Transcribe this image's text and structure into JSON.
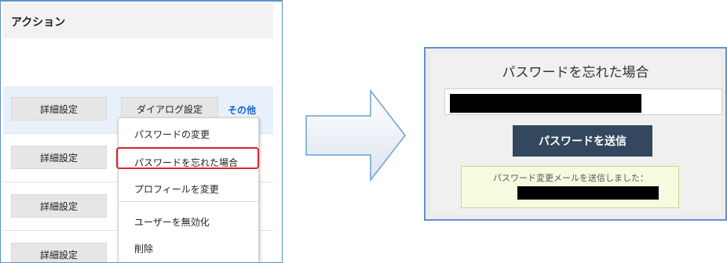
{
  "left": {
    "header": "アクション",
    "rows": [
      {
        "detail": "詳細設定",
        "dialog": "ダイアログ設定",
        "other": "その他"
      },
      {
        "detail": "詳細設定"
      },
      {
        "detail": "詳細設定"
      },
      {
        "detail": "詳細設定"
      }
    ],
    "menu": [
      "パスワードの変更",
      "パスワードを忘れた場合",
      "プロフィールを変更",
      "ユーザーを無効化",
      "削除"
    ]
  },
  "right": {
    "title": "パスワードを忘れた場合",
    "send_label": "パスワードを送信",
    "success_message": "パスワード変更メールを送信しました："
  },
  "colors": {
    "panel_border": "#5b92cc",
    "link": "#1a64c8",
    "highlight_border": "#e0202a",
    "send_button_bg": "#33485e",
    "success_bg": "#f6fbe0"
  },
  "icons": {
    "arrow": "right-arrow-icon"
  }
}
